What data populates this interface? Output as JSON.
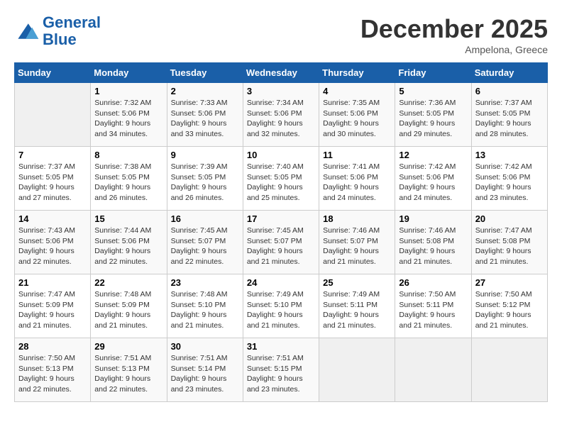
{
  "header": {
    "logo_line1": "General",
    "logo_line2": "Blue",
    "month": "December 2025",
    "location": "Ampelona, Greece"
  },
  "weekdays": [
    "Sunday",
    "Monday",
    "Tuesday",
    "Wednesday",
    "Thursday",
    "Friday",
    "Saturday"
  ],
  "weeks": [
    [
      {
        "day": "",
        "empty": true
      },
      {
        "day": "1",
        "sunrise": "7:32 AM",
        "sunset": "5:06 PM",
        "daylight": "9 hours and 34 minutes."
      },
      {
        "day": "2",
        "sunrise": "7:33 AM",
        "sunset": "5:06 PM",
        "daylight": "9 hours and 33 minutes."
      },
      {
        "day": "3",
        "sunrise": "7:34 AM",
        "sunset": "5:06 PM",
        "daylight": "9 hours and 32 minutes."
      },
      {
        "day": "4",
        "sunrise": "7:35 AM",
        "sunset": "5:06 PM",
        "daylight": "9 hours and 30 minutes."
      },
      {
        "day": "5",
        "sunrise": "7:36 AM",
        "sunset": "5:05 PM",
        "daylight": "9 hours and 29 minutes."
      },
      {
        "day": "6",
        "sunrise": "7:37 AM",
        "sunset": "5:05 PM",
        "daylight": "9 hours and 28 minutes."
      }
    ],
    [
      {
        "day": "7",
        "sunrise": "7:37 AM",
        "sunset": "5:05 PM",
        "daylight": "9 hours and 27 minutes."
      },
      {
        "day": "8",
        "sunrise": "7:38 AM",
        "sunset": "5:05 PM",
        "daylight": "9 hours and 26 minutes."
      },
      {
        "day": "9",
        "sunrise": "7:39 AM",
        "sunset": "5:05 PM",
        "daylight": "9 hours and 26 minutes."
      },
      {
        "day": "10",
        "sunrise": "7:40 AM",
        "sunset": "5:05 PM",
        "daylight": "9 hours and 25 minutes."
      },
      {
        "day": "11",
        "sunrise": "7:41 AM",
        "sunset": "5:06 PM",
        "daylight": "9 hours and 24 minutes."
      },
      {
        "day": "12",
        "sunrise": "7:42 AM",
        "sunset": "5:06 PM",
        "daylight": "9 hours and 24 minutes."
      },
      {
        "day": "13",
        "sunrise": "7:42 AM",
        "sunset": "5:06 PM",
        "daylight": "9 hours and 23 minutes."
      }
    ],
    [
      {
        "day": "14",
        "sunrise": "7:43 AM",
        "sunset": "5:06 PM",
        "daylight": "9 hours and 22 minutes."
      },
      {
        "day": "15",
        "sunrise": "7:44 AM",
        "sunset": "5:06 PM",
        "daylight": "9 hours and 22 minutes."
      },
      {
        "day": "16",
        "sunrise": "7:45 AM",
        "sunset": "5:07 PM",
        "daylight": "9 hours and 22 minutes."
      },
      {
        "day": "17",
        "sunrise": "7:45 AM",
        "sunset": "5:07 PM",
        "daylight": "9 hours and 21 minutes."
      },
      {
        "day": "18",
        "sunrise": "7:46 AM",
        "sunset": "5:07 PM",
        "daylight": "9 hours and 21 minutes."
      },
      {
        "day": "19",
        "sunrise": "7:46 AM",
        "sunset": "5:08 PM",
        "daylight": "9 hours and 21 minutes."
      },
      {
        "day": "20",
        "sunrise": "7:47 AM",
        "sunset": "5:08 PM",
        "daylight": "9 hours and 21 minutes."
      }
    ],
    [
      {
        "day": "21",
        "sunrise": "7:47 AM",
        "sunset": "5:09 PM",
        "daylight": "9 hours and 21 minutes."
      },
      {
        "day": "22",
        "sunrise": "7:48 AM",
        "sunset": "5:09 PM",
        "daylight": "9 hours and 21 minutes."
      },
      {
        "day": "23",
        "sunrise": "7:48 AM",
        "sunset": "5:10 PM",
        "daylight": "9 hours and 21 minutes."
      },
      {
        "day": "24",
        "sunrise": "7:49 AM",
        "sunset": "5:10 PM",
        "daylight": "9 hours and 21 minutes."
      },
      {
        "day": "25",
        "sunrise": "7:49 AM",
        "sunset": "5:11 PM",
        "daylight": "9 hours and 21 minutes."
      },
      {
        "day": "26",
        "sunrise": "7:50 AM",
        "sunset": "5:11 PM",
        "daylight": "9 hours and 21 minutes."
      },
      {
        "day": "27",
        "sunrise": "7:50 AM",
        "sunset": "5:12 PM",
        "daylight": "9 hours and 21 minutes."
      }
    ],
    [
      {
        "day": "28",
        "sunrise": "7:50 AM",
        "sunset": "5:13 PM",
        "daylight": "9 hours and 22 minutes."
      },
      {
        "day": "29",
        "sunrise": "7:51 AM",
        "sunset": "5:13 PM",
        "daylight": "9 hours and 22 minutes."
      },
      {
        "day": "30",
        "sunrise": "7:51 AM",
        "sunset": "5:14 PM",
        "daylight": "9 hours and 23 minutes."
      },
      {
        "day": "31",
        "sunrise": "7:51 AM",
        "sunset": "5:15 PM",
        "daylight": "9 hours and 23 minutes."
      },
      {
        "day": "",
        "empty": true
      },
      {
        "day": "",
        "empty": true
      },
      {
        "day": "",
        "empty": true
      }
    ]
  ],
  "labels": {
    "sunrise_prefix": "Sunrise: ",
    "sunset_prefix": "Sunset: ",
    "daylight_prefix": "Daylight: "
  }
}
